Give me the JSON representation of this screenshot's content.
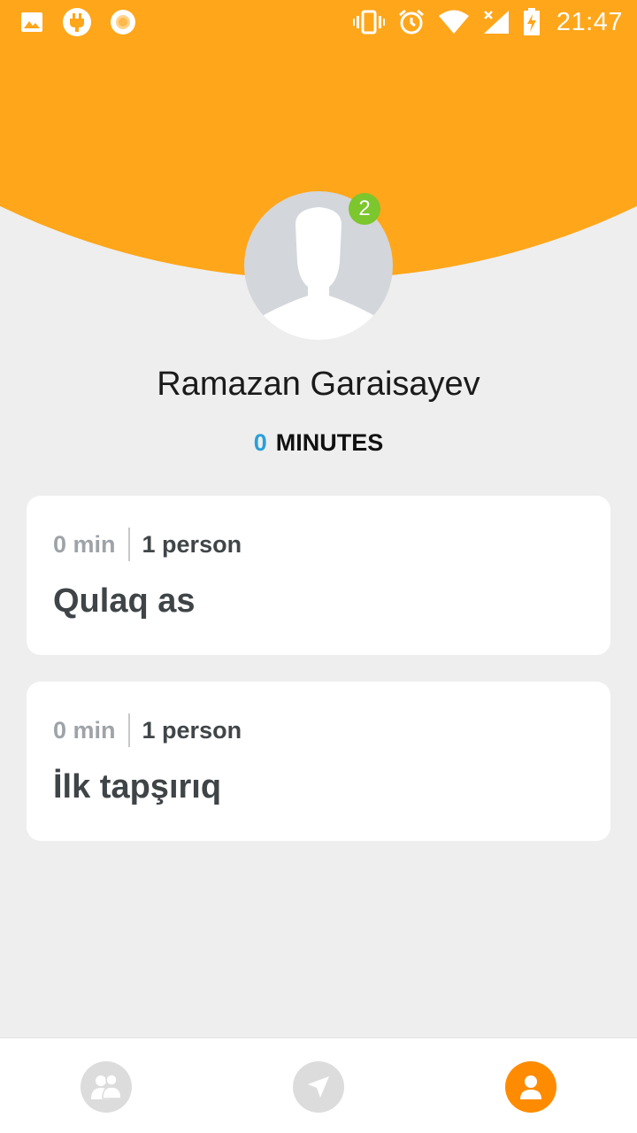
{
  "status_bar": {
    "time": "21:47",
    "left_icons": [
      "image-icon",
      "usb-plug-icon",
      "circle-record-icon"
    ],
    "right_icons": [
      "vibrate-icon",
      "alarm-icon",
      "wifi-icon",
      "cellular-no-data-icon",
      "battery-charging-icon"
    ]
  },
  "colors": {
    "header": "#ffa61a",
    "badge": "#7cc62e",
    "minutes_accent": "#2a9fd8",
    "active_nav": "#ff8c00",
    "background": "#eeeeee"
  },
  "profile": {
    "name": "Ramazan Garaisayev",
    "badge_count": "2",
    "minutes_value": "0",
    "minutes_label": "MINUTES",
    "avatar_icon": "default-avatar-silhouette-icon"
  },
  "tasks": [
    {
      "minutes": "0 min",
      "people": "1 person",
      "title": "Qulaq as"
    },
    {
      "minutes": "0 min",
      "people": "1 person",
      "title": "İlk tapşırıq"
    }
  ],
  "bottom_nav": {
    "items": [
      {
        "icon": "people-icon",
        "active": false
      },
      {
        "icon": "navigation-arrow-icon",
        "active": false
      },
      {
        "icon": "profile-icon",
        "active": true
      }
    ]
  }
}
